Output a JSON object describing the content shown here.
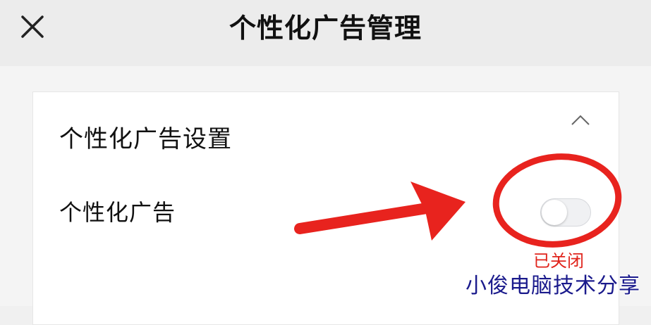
{
  "header": {
    "close_icon": "close-icon",
    "title": "个性化广告管理"
  },
  "card": {
    "section_title": "个性化广告设置",
    "collapse_icon": "chevron-up-icon",
    "row": {
      "label": "个性化广告",
      "toggle_on": false,
      "status": "已关闭"
    }
  },
  "watermark": "小俊电脑技术分享",
  "colors": {
    "header_bg": "#ececec",
    "annotation_red": "#e8231e",
    "status_red": "#e0231b",
    "watermark_blue": "#1a1a8c"
  }
}
